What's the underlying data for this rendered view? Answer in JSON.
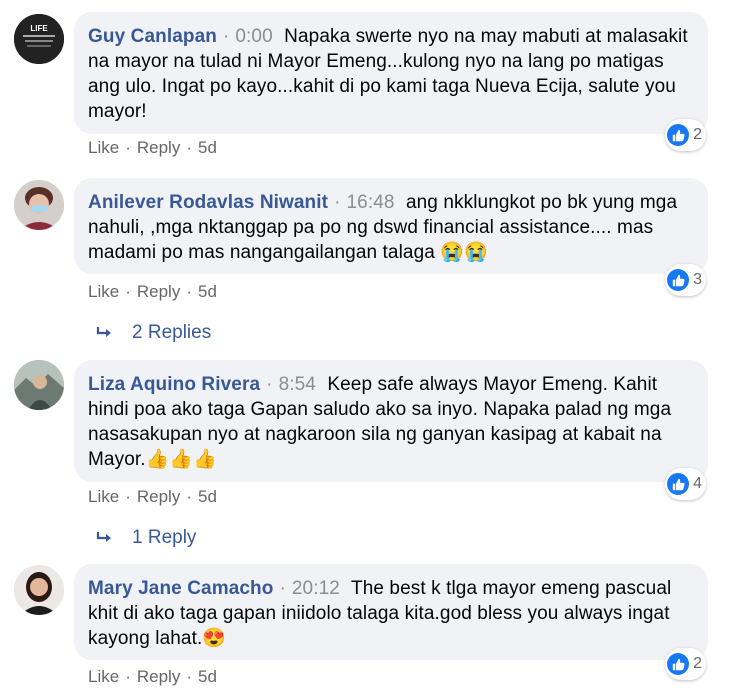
{
  "comments": [
    {
      "author": "Guy Canlapan",
      "time": "0:00",
      "text": "Napaka swerte nyo na may mabuti at malasakit na mayor na tulad ni Mayor Emeng...kulong nyo na lang po matigas ang ulo. Ingat po kayo...kahit di po kami taga Nueva Ecija, salute you mayor!",
      "reactions": "2",
      "like": "Like",
      "reply": "Reply",
      "age": "5d",
      "avatar_text": "LIFE"
    },
    {
      "author": "Anilever Rodavlas Niwanit",
      "time": "16:48",
      "text": "ang nkklungkot po bk yung mga nahuli, ,mga nktanggap pa po ng dswd financial assistance.... mas madami po mas nangangailangan talaga",
      "emoji": "😭😭",
      "reactions": "3",
      "like": "Like",
      "reply": "Reply",
      "age": "5d",
      "replies_label": "2 Replies"
    },
    {
      "author": "Liza Aquino Rivera",
      "time": "8:54",
      "text": "Keep safe always Mayor Emeng. Kahit hindi poa ako taga Gapan saludo ako sa inyo. Napaka palad ng mga nasasakupan nyo at nagkaroon sila ng ganyan kasipag at kabait na Mayor.",
      "emoji": "👍👍👍",
      "reactions": "4",
      "like": "Like",
      "reply": "Reply",
      "age": "5d",
      "replies_label": "1 Reply"
    },
    {
      "author": "Mary Jane Camacho",
      "time": "20:12",
      "text": "The best k tlga mayor emeng pascual khit di ako taga gapan iniidolo talaga kita.god bless you always ingat kayong lahat.",
      "emoji": "😍",
      "reactions": "2",
      "like": "Like",
      "reply": "Reply",
      "age": "5d"
    }
  ],
  "colors": {
    "author": "#385898",
    "bubble": "#f0f2f5",
    "meta": "#65676b",
    "like_badge": "#1877f2"
  },
  "icons": {
    "reaction": "thumbs-up-icon",
    "reply_arrow": "reply-arrow-icon"
  }
}
